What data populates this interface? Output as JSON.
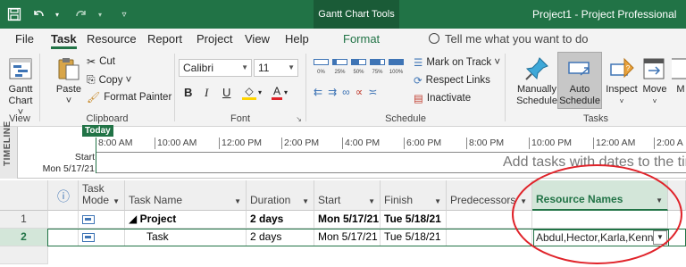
{
  "titlebar": {
    "context_tab": "Gantt Chart Tools",
    "title": "Project1  -  Project Professional"
  },
  "qat": {
    "save_icon": "save-icon",
    "undo_icon": "undo-icon",
    "redo_icon": "redo-icon",
    "customize_icon": "customize-qat-icon"
  },
  "tabs": {
    "file": "File",
    "task": "Task",
    "resource": "Resource",
    "report": "Report",
    "project": "Project",
    "view": "View",
    "help": "Help",
    "format": "Format",
    "tell_me": "Tell me what you want to do"
  },
  "ribbon": {
    "view_group": {
      "gantt_chart": "Gantt",
      "gantt_chart_2": "Chart ˅",
      "label": "View"
    },
    "clipboard": {
      "paste": "Paste",
      "paste_dd": "˅",
      "cut": "Cut",
      "copy": "Copy  ˅",
      "format_painter": "Format Painter",
      "label": "Clipboard"
    },
    "font": {
      "font_name": "Calibri",
      "font_size": "11",
      "bold": "B",
      "italic": "I",
      "underline": "U",
      "label": "Font"
    },
    "schedule": {
      "mark_on_track": "Mark on Track  ˅",
      "respect_links": "Respect Links",
      "inactivate": "Inactivate",
      "label": "Schedule",
      "pct": [
        "0%",
        "25%",
        "50%",
        "75%",
        "100%"
      ]
    },
    "tasks": {
      "manually": "Manually",
      "manually_2": "Schedule",
      "auto": "Auto",
      "auto_2": "Schedule",
      "inspect": "Inspect",
      "move": "Move",
      "mode": "M",
      "label": "Tasks"
    }
  },
  "timeline": {
    "side_label": "TIMELINE",
    "today": "Today",
    "start_label": "Start",
    "start_date": "Mon 5/17/21",
    "ticks": [
      "8:00 AM",
      "10:00 AM",
      "12:00 PM",
      "2:00 PM",
      "4:00 PM",
      "6:00 PM",
      "8:00 PM",
      "10:00 PM",
      "12:00 AM",
      "2:00 A"
    ],
    "placeholder": "Add tasks with dates to the tin"
  },
  "grid": {
    "headers": {
      "info": "ⓘ",
      "task_mode": "Task\nMode",
      "task_name": "Task Name",
      "duration": "Duration",
      "start": "Start",
      "finish": "Finish",
      "predecessors": "Predecessors",
      "resource_names": "Resource Names"
    },
    "rows": [
      {
        "num": "1",
        "name": "◢ Project",
        "duration": "2 days",
        "start": "Mon 5/17/21",
        "finish": "Tue 5/18/21",
        "predecessors": "",
        "resources": ""
      },
      {
        "num": "2",
        "name": "Task",
        "duration": "2 days",
        "start": "Mon 5/17/21",
        "finish": "Tue 5/18/21",
        "predecessors": "",
        "resources": "Abdul,Hector,Karla,Kenny"
      }
    ]
  },
  "colors": {
    "accent": "#217346",
    "annotation": "#e0232a"
  }
}
